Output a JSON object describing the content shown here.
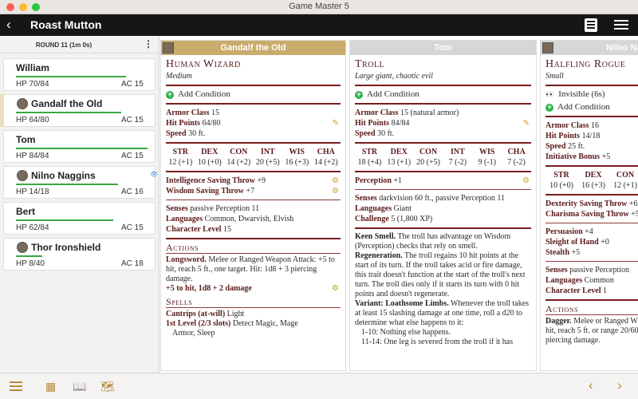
{
  "window": {
    "title": "Game Master 5"
  },
  "appbar": {
    "back_icon": "‹",
    "title": "Roast Mutton"
  },
  "sidebar": {
    "round_label": "ROUND 11 (1m 0s)",
    "more_icon": "⋮",
    "combatants": [
      {
        "name": "William",
        "hp": "HP 70/84",
        "ac": "AC 15"
      },
      {
        "name": "Gandalf the Old",
        "hp": "HP 64/80",
        "ac": "AC 15"
      },
      {
        "name": "Tom",
        "hp": "HP 84/84",
        "ac": "AC 15"
      },
      {
        "name": "Nilno Naggins",
        "hp": "HP 14/18",
        "ac": "AC 16",
        "status_icon": "👁"
      },
      {
        "name": "Bert",
        "hp": "HP 62/84",
        "ac": "AC 15"
      },
      {
        "name": "Thor Ironshield",
        "hp": "HP 8/40",
        "ac": "AC 18"
      }
    ]
  },
  "cols": {
    "gandalf": {
      "header": "Gandalf the Old",
      "header_color": "#c9ab6b",
      "title": "Human Wizard",
      "subtitle": "Medium",
      "add_condition": "Add Condition",
      "armor_label": "Armor Class",
      "armor_value": "15",
      "hp_label": "Hit Points",
      "hp_value": "64/80",
      "speed_label": "Speed",
      "speed_value": "30 ft.",
      "abilities": [
        {
          "n": "STR",
          "v": "12 (+1)"
        },
        {
          "n": "DEX",
          "v": "10 (+0)"
        },
        {
          "n": "CON",
          "v": "14 (+2)"
        },
        {
          "n": "INT",
          "v": "20 (+5)"
        },
        {
          "n": "WIS",
          "v": "16 (+3)"
        },
        {
          "n": "CHA",
          "v": "14 (+2)"
        }
      ],
      "save1_label": "Intelligence Saving Throw",
      "save1_value": "+9",
      "save2_label": "Wisdom Saving Throw",
      "save2_value": "+7",
      "senses_label": "Senses",
      "senses_value": "passive Perception 11",
      "lang_label": "Languages",
      "lang_value": "Common, Dwarvish, Elvish",
      "level_label": "Character Level",
      "level_value": "15",
      "actions_heading": "Actions",
      "action_name": "Longsword.",
      "action_text": "Melee or Ranged Weapon Attack: +5 to hit, reach 5 ft., one target. Hit: 1d8 + 3 piercing damage.",
      "action_roll": "+5 to hit, 1d8 + 2 damage",
      "spells_heading": "Spells",
      "cantrips_label": "Cantrips (at-will)",
      "cantrips_value": "Light",
      "level1_label": "1st Level (2/3 slots)",
      "level1_value": "Detect Magic, Mage",
      "level1_cont": "Armor, Sleep"
    },
    "tom": {
      "header": "Tom",
      "header_color": "#d6d6d6",
      "title": "Troll",
      "subtitle": "Large giant, chaotic evil",
      "add_condition": "Add Condition",
      "armor_label": "Armor Class",
      "armor_value": "15 (natural armor)",
      "hp_label": "Hit Points",
      "hp_value": "84/84",
      "speed_label": "Speed",
      "speed_value": "30 ft.",
      "abilities": [
        {
          "n": "STR",
          "v": "18 (+4)"
        },
        {
          "n": "DEX",
          "v": "13 (+1)"
        },
        {
          "n": "CON",
          "v": "20 (+5)"
        },
        {
          "n": "INT",
          "v": "7 (-2)"
        },
        {
          "n": "WIS",
          "v": "9 (-1)"
        },
        {
          "n": "CHA",
          "v": "7 (-2)"
        }
      ],
      "perception_label": "Perception",
      "perception_value": "+1",
      "senses_label": "Senses",
      "senses_value": "darkvision 60 ft., passive Perception 11",
      "lang_label": "Languages",
      "lang_value": "Giant",
      "challenge_label": "Challenge",
      "challenge_value": "5 (1,800 XP)",
      "keen_label": "Keen Smell.",
      "keen_text": "The troll has advantage on Wisdom (Perception) checks that rely on smell.",
      "regen_label": "Regeneration.",
      "regen_text": "The troll regains 10 hit points at the start of its turn. If the troll takes acid or fire damage, this trait doesn't function at the start of the troll's next turn. The troll dies only if it starts its turn with 0 hit points and doesn't regenerate.",
      "variant_label": "Variant: Loathsome Limbs.",
      "variant_text": "Whenever the troll takes at least 15 slashing damage at one time, roll a d20 to determine what else happens to it:",
      "roll1": "1-10: Nothing else happens.",
      "roll2": "11-14: One leg is severed from the troll if it has"
    },
    "nilno": {
      "header": "Nilno Na",
      "header_color": "#d6d6d6",
      "title": "Halfling Rogue",
      "subtitle": "Small",
      "invisible": "Invisible (6s)",
      "add_condition": "Add Condition",
      "armor_label": "Armor Class",
      "armor_value": "16",
      "hp_label": "Hit Points",
      "hp_value": "14/18",
      "speed_label": "Speed",
      "speed_value": "25 ft.",
      "init_label": "Initiative Bonus",
      "init_value": "+5",
      "abilities": [
        {
          "n": "STR",
          "v": "10 (+0)"
        },
        {
          "n": "DEX",
          "v": "16 (+3)"
        },
        {
          "n": "CON",
          "v": "12 (+1)"
        }
      ],
      "dex_save_label": "Dexterity Saving Throw",
      "dex_save_value": "+6",
      "cha_save_label": "Charisma Saving Throw",
      "cha_save_value": "+5",
      "persuasion_label": "Persuasion",
      "persuasion_value": "+4",
      "sleight_label": "Sleight of Hand",
      "sleight_value": "+0",
      "stealth_label": "Stealth",
      "stealth_value": "+5",
      "senses_label": "Senses",
      "senses_value": "passive Perception",
      "lang_label": "Languages",
      "lang_value": "Common",
      "level_label": "Character Level",
      "level_value": "1",
      "actions_heading": "Actions",
      "dagger_label": "Dagger.",
      "dagger_text": "Melee or Ranged W",
      "dagger_text2": "hit, reach 5 ft. or range 20/60 ft",
      "dagger_text3": "piercing damage."
    }
  },
  "bottombar": {
    "grid_icon": "▦",
    "book_icon": "📖",
    "map_icon": "🗺",
    "prev_icon": "‹",
    "next_icon": "›"
  },
  "colors": {
    "accent": "#b88a3a",
    "statblock": "#7a1c1c",
    "hp_bar": "#3aa845"
  }
}
